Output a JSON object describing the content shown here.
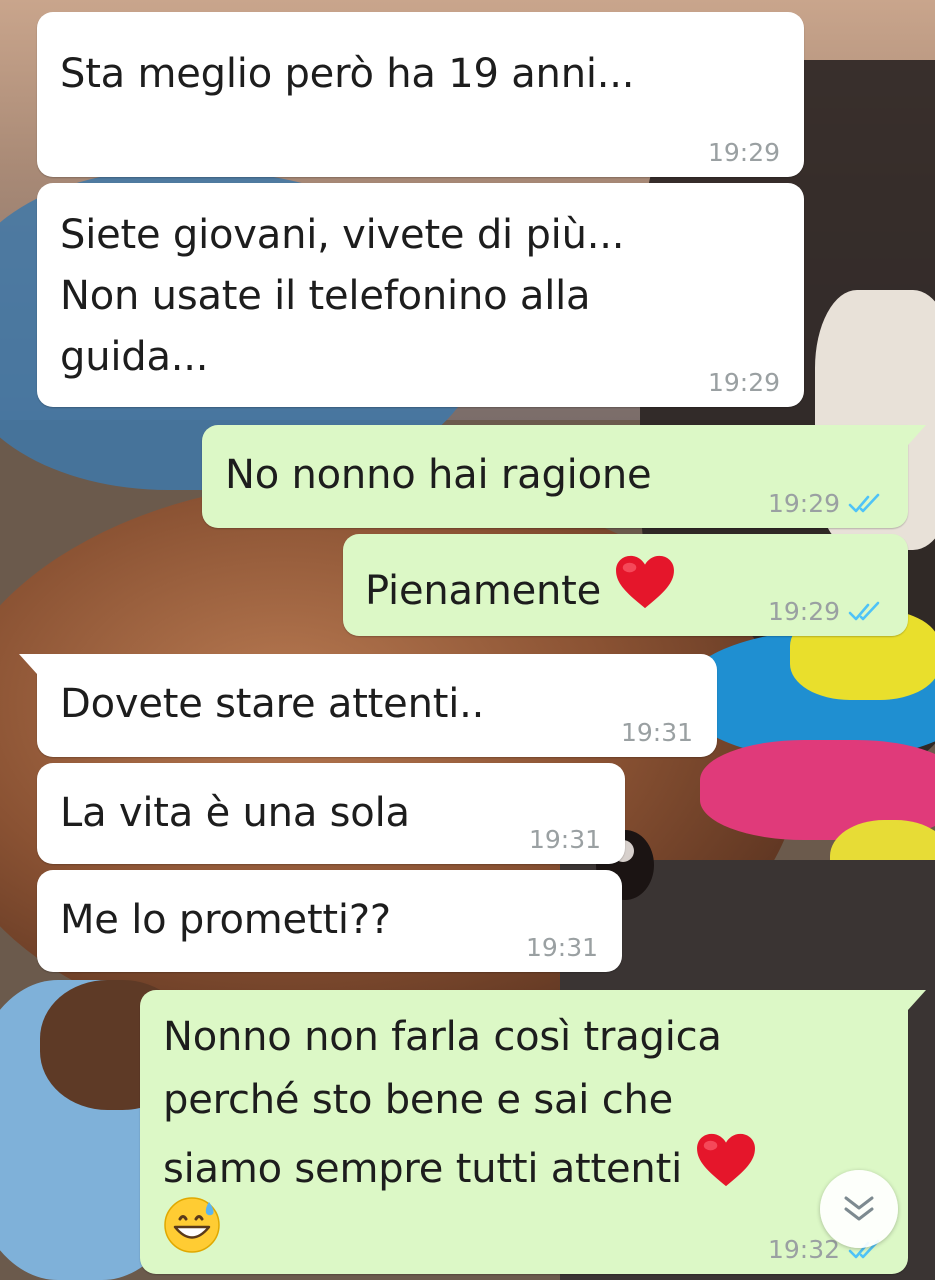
{
  "colors": {
    "incoming_bubble": "#ffffff",
    "outgoing_bubble": "#dcf8c6",
    "read_ticks": "#4fc3f7",
    "timestamp": "#9aa0a2",
    "heart": "#e5162b"
  },
  "icons": {
    "read_receipt": "double-check-icon",
    "heart": "red-heart-emoji",
    "sweat_smile": "grinning-face-with-sweat-emoji",
    "scroll_down": "double-chevron-down-icon"
  },
  "messages": [
    {
      "direction": "incoming",
      "text": "Sta meglio però ha 19 anni...",
      "time": "19:29"
    },
    {
      "direction": "incoming",
      "text": "Siete giovani, vivete di più...\nNon usate il telefonino alla\nguida...",
      "time": "19:29"
    },
    {
      "direction": "outgoing",
      "text": "No nonno hai ragione",
      "time": "19:29",
      "status": "read"
    },
    {
      "direction": "outgoing",
      "text": "Pienamente",
      "time": "19:29",
      "status": "read",
      "emoji_after": "red-heart-emoji"
    },
    {
      "direction": "incoming",
      "text": "Dovete stare attenti..",
      "time": "19:31"
    },
    {
      "direction": "incoming",
      "text": "La vita è una sola",
      "time": "19:31"
    },
    {
      "direction": "incoming",
      "text": "Me lo prometti??",
      "time": "19:31"
    },
    {
      "direction": "outgoing",
      "text": "Nonno non farla così tragica\nperché sto bene e sai che\nsiamo sempre tutti attenti",
      "time": "19:32",
      "status": "read",
      "emoji_after": "red-heart-emoji",
      "emoji_line": "grinning-face-with-sweat-emoji"
    }
  ]
}
